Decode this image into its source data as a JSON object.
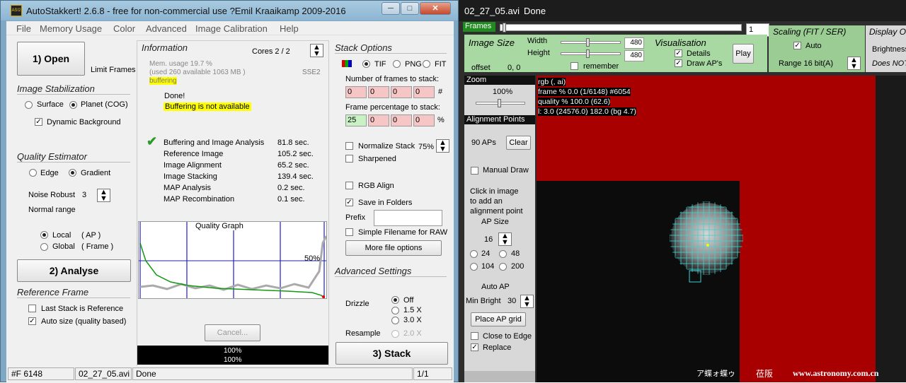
{
  "win1": {
    "title": "AutoStakkert! 2.6.8 - free for non-commercial use ?Emil Kraaikamp 2009-2016",
    "icon_text": "AS!2",
    "minimize": "─",
    "maximize": "□",
    "close": "✕",
    "menu": [
      "File",
      "Memory Usage",
      "Color",
      "Advanced",
      "Image Calibration",
      "Help"
    ],
    "open_button": "1) Open",
    "limit_frames": "Limit Frames",
    "stab_title": "Image Stabilization",
    "surface": "Surface",
    "planet": "Planet (COG)",
    "dyn_bg": "Dynamic Background",
    "qe_title": "Quality Estimator",
    "edge": "Edge",
    "gradient": "Gradient",
    "noise_robust": "Noise Robust",
    "noise_value": "3",
    "normal_range": "Normal range",
    "local": "Local",
    "local_ap": "( AP )",
    "global": "Global",
    "global_frame": "( Frame )",
    "analyse_button": "2) Analyse",
    "ref_title": "Reference Frame",
    "last_stack": "Last Stack is Reference",
    "auto_size": "Auto size (quality based)",
    "info_title": "Information",
    "cores": "Cores 2 / 2",
    "mem_usage": "Mem. usage 19.7 %",
    "mem_used": "(used 260 available 1063 MB )",
    "buffering": "buffering",
    "sse": "SSE2",
    "done": "Done!",
    "buffer_na": "Buffering is not available",
    "timings": [
      {
        "label": "Buffering and Image Analysis",
        "value": "81.8 sec."
      },
      {
        "label": "Reference Image",
        "value": "105.2 sec."
      },
      {
        "label": "Image Alignment",
        "value": "65.2 sec."
      },
      {
        "label": "Image Stacking",
        "value": "139.4 sec."
      },
      {
        "label": "MAP Analysis",
        "value": "0.2 sec."
      },
      {
        "label": "MAP Recombination",
        "value": "0.1 sec."
      }
    ],
    "quality_graph": "Quality Graph",
    "pct50": "50%",
    "cancel": "Cancel...",
    "progress1": "100%",
    "progress2": "100%",
    "stack_title": "Stack Options",
    "tif": "TIF",
    "png": "PNG",
    "fit": "FIT",
    "num_frames": "Number of frames to stack:",
    "num_values": [
      "0",
      "0",
      "0",
      "0"
    ],
    "hash": "#",
    "frame_pct": "Frame percentage to stack:",
    "pct_values": [
      "25",
      "0",
      "0",
      "0"
    ],
    "pct_sign": "%",
    "normalize": "Normalize Stack",
    "normalize_pct": "75%",
    "sharpened": "Sharpened",
    "rgb_align": "RGB Align",
    "save_folders": "Save in Folders",
    "prefix": "Prefix",
    "simple_fname": "Simple Filename for RAW",
    "more_file": "More file options",
    "adv_title": "Advanced Settings",
    "drizzle": "Drizzle",
    "off": "Off",
    "x15": "1.5 X",
    "x30": "3.0 X",
    "resample": "Resample",
    "x20": "2.0 X",
    "stack_button": "3) Stack",
    "status_frames": "#F 6148",
    "status_file": "02_27_05.avi",
    "status_done": "Done",
    "status_page": "1/1"
  },
  "win2": {
    "title_file": "02_27_05.avi",
    "title_status": "Done",
    "frames": "Frames",
    "frame_num": "1",
    "image_size": "Image Size",
    "width": "Width",
    "height": "Height",
    "width_val": "480",
    "height_val": "480",
    "remember": "remember",
    "offset": "offset",
    "offset_val": "0, 0",
    "vis_title": "Visualisation",
    "details": "Details",
    "draw_aps": "Draw AP's",
    "play": "Play",
    "scaling": "Scaling (FIT / SER)",
    "auto": "Auto",
    "range": "Range 16 bit(A)",
    "display": "Display O",
    "brightness": "Brightness",
    "does_not": "Does NOT",
    "zoom_title": "Zoom",
    "zoom_val": "100%",
    "ap_title": "Alignment Points",
    "ap_count": "90 APs",
    "clear": "Clear",
    "manual_draw": "Manual Draw",
    "click_hint": "Click in image\nto add an\nalignment point",
    "ap_size": "AP Size",
    "ap_size_val": "16",
    "s24": "24",
    "s48": "48",
    "s104": "104",
    "s200": "200",
    "auto_ap": "Auto AP",
    "min_bright": "Min Bright",
    "min_bright_val": "30",
    "place_grid": "Place AP grid",
    "close_edge": "Close to Edge",
    "replace": "Replace",
    "ov1": "rgb (, ai)",
    "ov2": "frame % 0.0 (1/6148) #6054",
    "ov3": "quality % 100.0  (62.6)",
    "ov4": "l: 3.0 (24576.0) 182.0 (bg 4.7)",
    "wm1": "ア蝶ォ蝶ゥ",
    "wm2": "莅阪",
    "wm3": "www.astronomy.com.cn"
  },
  "colors": {
    "image_bg": "#a80000",
    "ap_box": "#3bd3d3"
  }
}
